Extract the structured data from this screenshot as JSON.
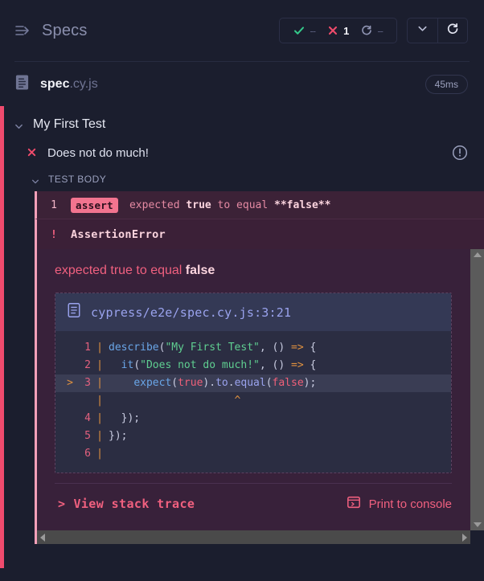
{
  "header": {
    "panel_toggle_icon": "collapse-panel-icon",
    "title": "Specs",
    "stats": [
      {
        "icon": "check-icon",
        "label": "passed",
        "value": "--"
      },
      {
        "icon": "x-icon",
        "label": "failed",
        "value": "1"
      },
      {
        "icon": "pending-icon",
        "label": "pending",
        "value": "--"
      }
    ],
    "chevron_icon": "chevron-down-icon",
    "reload_icon": "reload-icon"
  },
  "spec": {
    "file_icon": "file-icon",
    "name_base": "spec",
    "name_ext": ".cy.js",
    "duration": "45ms"
  },
  "suite": {
    "chevron_icon": "chevron-down-icon",
    "title": "My First Test"
  },
  "test": {
    "status_icon": "x-icon",
    "title": "Does not do much!",
    "alert_icon": "exclamation-circle-icon"
  },
  "test_body": {
    "chevron_icon": "chevron-down-icon",
    "label": "TEST BODY"
  },
  "command": {
    "number": "1",
    "badge": "assert",
    "message_prefix": "expected ",
    "message_true": "true",
    "message_mid": " to equal ",
    "message_false": "**false**"
  },
  "error_header": {
    "bang": "!",
    "name": "AssertionError"
  },
  "error": {
    "message_prefix": "expected true to equal ",
    "message_bold": "false",
    "file_icon": "file-icon",
    "file_path": "cypress/e2e/spec.cy.js:3:21"
  },
  "code": {
    "lines": [
      {
        "marker": "",
        "no": "1",
        "bar": "|",
        "text": "describe(\"My First Test\", () => {",
        "highlight": false
      },
      {
        "marker": "",
        "no": "2",
        "bar": "|",
        "text": "  it(\"Does not do much!\", () => {",
        "highlight": false
      },
      {
        "marker": ">",
        "no": "3",
        "bar": "|",
        "text": "    expect(true).to.equal(false);",
        "highlight": true
      },
      {
        "marker": "",
        "no": "",
        "bar": "|",
        "text": "                    ^",
        "highlight": false
      },
      {
        "marker": "",
        "no": "4",
        "bar": "|",
        "text": "  });",
        "highlight": false
      },
      {
        "marker": "",
        "no": "5",
        "bar": "|",
        "text": "});",
        "highlight": false
      },
      {
        "marker": "",
        "no": "6",
        "bar": "|",
        "text": "",
        "highlight": false
      }
    ]
  },
  "footer": {
    "stack_chevron": ">",
    "stack_label": "View stack trace",
    "console_icon": "console-window-icon",
    "console_label": "Print to console"
  },
  "scrollbar": {
    "up_icon": "scroll-up-arrow-icon",
    "down_icon": "scroll-down-arrow-icon",
    "left_icon": "scroll-left-arrow-icon",
    "right_icon": "scroll-right-arrow-icon"
  },
  "colors": {
    "background": "#1b1e2e",
    "fail_accent": "#f04b6e",
    "pass_green": "#34c98a",
    "link_indigo": "#9aa3ee",
    "error_panel": "#38213a"
  }
}
